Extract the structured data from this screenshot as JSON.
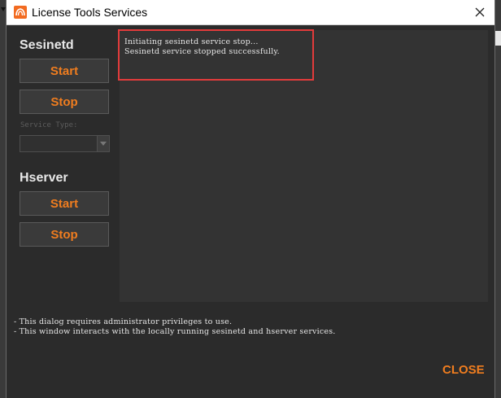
{
  "window": {
    "title": "License Tools Services",
    "icons": {
      "app": "houdini-logo-icon",
      "close": "close-icon"
    }
  },
  "sesinetd": {
    "heading": "Sesinetd",
    "start_label": "Start",
    "stop_label": "Stop",
    "service_type_label": "Service Type:",
    "service_type_value": ""
  },
  "hserver": {
    "heading": "Hserver",
    "start_label": "Start",
    "stop_label": "Stop"
  },
  "log": {
    "lines": [
      "Initiating sesinetd service stop...",
      "Sesinetd service stopped successfully."
    ]
  },
  "notes": [
    "- This dialog requires administrator privileges to use.",
    "- This window interacts with the locally running sesinetd and hserver services."
  ],
  "footer": {
    "close_label": "CLOSE"
  },
  "colors": {
    "accent": "#f07d1f",
    "highlight": "#e23b3b",
    "background": "#2b2b2b",
    "log_background": "#333333"
  }
}
